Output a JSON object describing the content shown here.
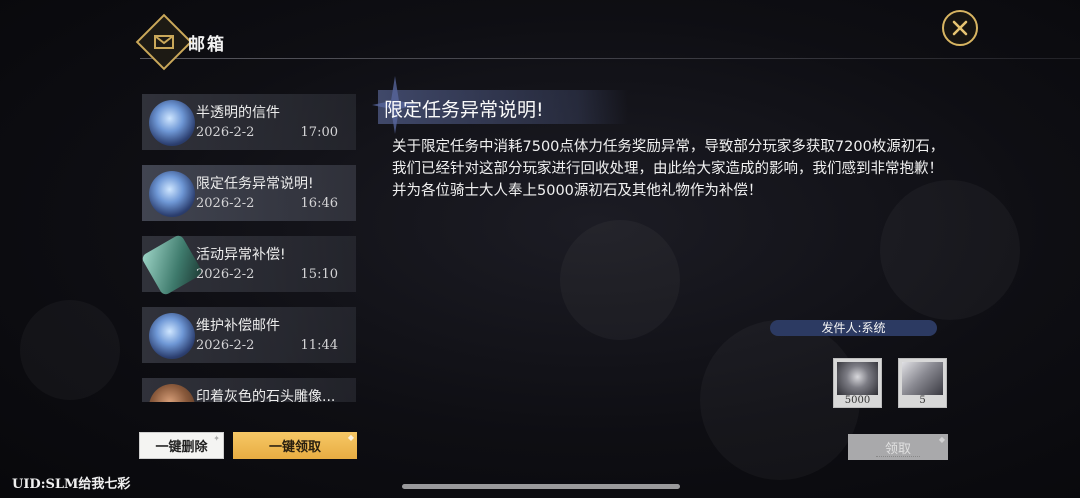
{
  "header": {
    "title": "邮箱",
    "close_icon": "close-icon",
    "emblem_icon": "mail-emblem-icon"
  },
  "mail_list": [
    {
      "title": "半透明的信件",
      "date": "2026-2-2",
      "time": "17:00",
      "icon": "blue-crystal-icon",
      "selected": false
    },
    {
      "title": "限定任务异常说明!",
      "date": "2026-2-2",
      "time": "16:46",
      "icon": "blue-crystal-icon",
      "selected": true
    },
    {
      "title": "活动异常补偿!",
      "date": "2026-2-2",
      "time": "15:10",
      "icon": "green-ticket-icon",
      "selected": false
    },
    {
      "title": "维护补偿邮件",
      "date": "2026-2-2",
      "time": "11:44",
      "icon": "blue-crystal-icon",
      "selected": false
    },
    {
      "title": "印着灰色的石头雕像...",
      "date": "",
      "time": "",
      "icon": "brown-stone-icon",
      "selected": false
    }
  ],
  "buttons": {
    "delete_all": "一键删除",
    "claim_all": "一键领取",
    "claim": "领取"
  },
  "uid_text": "UID:SLM给我七彩",
  "detail": {
    "title": "限定任务异常说明!",
    "body": "关于限定任务中消耗7500点体力任务奖励异常，导致部分玩家多获取7200枚源初石，我们已经针对这部分玩家进行回收处理，由此给大家造成的影响，我们感到非常抱歉！并为各位骑士大人奉上5000源初石及其他礼物作为补偿！",
    "sender": "发件人:系统"
  },
  "rewards": [
    {
      "icon": "source-stone-icon",
      "count": "5000"
    },
    {
      "icon": "ticket-icon",
      "count": "5"
    }
  ],
  "colors": {
    "accent_gold": "#e8ad42",
    "title_bar": "#485278",
    "sender_bar": "#2c3a62"
  }
}
